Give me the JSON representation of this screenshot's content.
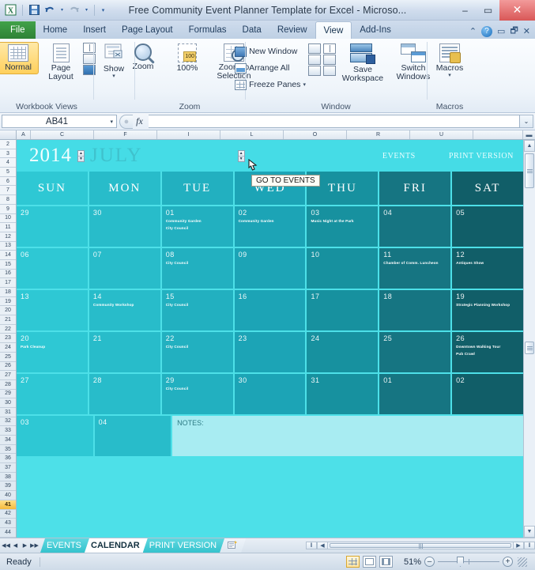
{
  "window": {
    "title": "Free Community Event Planner Template for Excel  -  Microso...",
    "minimize": "–",
    "maximize": "▭",
    "close": "✕",
    "app_icon": "X"
  },
  "quick_access": {
    "save": "save-icon",
    "undo": "↰",
    "undo_caret": "▾",
    "redo": "↱",
    "redo_caret": "▾",
    "customize": "▾"
  },
  "ribbon_tabs": {
    "file": "File",
    "items": [
      "Home",
      "Insert",
      "Page Layout",
      "Formulas",
      "Data",
      "Review",
      "View",
      "Add-Ins"
    ],
    "active": "View",
    "right_icons": [
      "up-caret-icon",
      "help-icon",
      "minimize-ribbon-icon",
      "restore-window-icon",
      "close-window-icon"
    ],
    "help_glyph": "?"
  },
  "ribbon": {
    "groups": [
      {
        "label": "Workbook Views",
        "buttons": [
          {
            "label_line1": "Normal",
            "label_line2": "",
            "selected": true
          },
          {
            "label_line1": "Page",
            "label_line2": "Layout",
            "selected": false
          }
        ]
      },
      {
        "label": "",
        "buttons": [
          {
            "label_line1": "Show",
            "label_line2": "",
            "caret": "▾"
          }
        ]
      },
      {
        "label": "Zoom",
        "buttons": [
          {
            "label_line1": "Zoom",
            "label_line2": ""
          },
          {
            "label_line1": "100%",
            "label_line2": ""
          },
          {
            "label_line1": "Zoom to",
            "label_line2": "Selection"
          }
        ]
      },
      {
        "label": "Window",
        "small_items": [
          "New Window",
          "Arrange All",
          "Freeze Panes"
        ],
        "freeze_caret": "▾",
        "buttons": [
          {
            "label_line1": "Save",
            "label_line2": "Workspace"
          },
          {
            "label_line1": "Switch",
            "label_line2": "Windows",
            "caret": "▾"
          }
        ]
      },
      {
        "label": "Macros",
        "buttons": [
          {
            "label_line1": "Macros",
            "label_line2": "",
            "caret": "▾"
          }
        ]
      }
    ]
  },
  "formula_bar": {
    "name_box_value": "AB41",
    "name_box_arrow": "▾",
    "cancel": "×",
    "enter": "✓",
    "fx": "fx",
    "formula_value": "",
    "expand_arrow": "⌄"
  },
  "grid": {
    "column_headers": [
      "A",
      "C",
      "F",
      "I",
      "L",
      "O",
      "R",
      "U"
    ],
    "row_numbers": [
      2,
      3,
      4,
      5,
      6,
      7,
      8,
      9,
      10,
      11,
      12,
      13,
      14,
      15,
      16,
      17,
      18,
      19,
      20,
      21,
      22,
      23,
      24,
      25,
      26,
      27,
      28,
      29,
      30,
      31,
      32,
      33,
      34,
      35,
      36,
      37,
      38,
      39,
      40,
      41,
      42,
      43,
      44
    ],
    "selected_row": 41,
    "select_all_corner": "select-all-icon"
  },
  "calendar": {
    "year": "2014",
    "month": "JULY",
    "links": [
      "EVENTS",
      "PRINT VERSION"
    ],
    "day_headers": [
      "SUN",
      "MON",
      "TUE",
      "WED",
      "THU",
      "FRI",
      "SAT"
    ],
    "notes_label": "NOTES:",
    "weeks": [
      [
        {
          "day": "29",
          "events": []
        },
        {
          "day": "30",
          "events": []
        },
        {
          "day": "01",
          "events": [
            "Community Garden",
            "City Council"
          ]
        },
        {
          "day": "02",
          "events": [
            "Community Garden"
          ]
        },
        {
          "day": "03",
          "events": [
            "Music Night at the Park"
          ]
        },
        {
          "day": "04",
          "events": []
        },
        {
          "day": "05",
          "events": []
        }
      ],
      [
        {
          "day": "06",
          "events": []
        },
        {
          "day": "07",
          "events": []
        },
        {
          "day": "08",
          "events": [
            "City Council"
          ]
        },
        {
          "day": "09",
          "events": []
        },
        {
          "day": "10",
          "events": []
        },
        {
          "day": "11",
          "events": [
            "Chamber of Comm. Luncheon"
          ]
        },
        {
          "day": "12",
          "events": [
            "Antiques Show"
          ]
        }
      ],
      [
        {
          "day": "13",
          "events": []
        },
        {
          "day": "14",
          "events": [
            "Community Workshop"
          ]
        },
        {
          "day": "15",
          "events": [
            "City Council"
          ]
        },
        {
          "day": "16",
          "events": []
        },
        {
          "day": "17",
          "events": []
        },
        {
          "day": "18",
          "events": []
        },
        {
          "day": "19",
          "events": [
            "Strategic Planning Workshop"
          ]
        }
      ],
      [
        {
          "day": "20",
          "events": [
            "Park Cleanup"
          ]
        },
        {
          "day": "21",
          "events": []
        },
        {
          "day": "22",
          "events": [
            "City Council"
          ]
        },
        {
          "day": "23",
          "events": []
        },
        {
          "day": "24",
          "events": []
        },
        {
          "day": "25",
          "events": []
        },
        {
          "day": "26",
          "events": [
            "Downtown Walking Tour",
            "Pub Crawl"
          ]
        }
      ],
      [
        {
          "day": "27",
          "events": []
        },
        {
          "day": "28",
          "events": []
        },
        {
          "day": "29",
          "events": [
            "City Council"
          ]
        },
        {
          "day": "30",
          "events": []
        },
        {
          "day": "31",
          "events": []
        },
        {
          "day": "01",
          "events": []
        },
        {
          "day": "02",
          "events": []
        }
      ],
      [
        {
          "day": "03",
          "events": []
        },
        {
          "day": "04",
          "events": []
        }
      ]
    ],
    "colors": {
      "background": "#4de0e8",
      "header_band": "#45dce6",
      "month_text": "#3fc2cd",
      "notes_bg": "#a8ecf2",
      "col_sun": "#2ec8d4",
      "col_mon": "#28bcca",
      "col_tue": "#22b0c0",
      "col_wed": "#1ca4b6",
      "col_thu": "#17919f",
      "col_fri": "#167582",
      "col_sat": "#115e68"
    }
  },
  "tooltip": {
    "text": "GO TO EVENTS"
  },
  "sheet_tabs": {
    "items": [
      {
        "label": "EVENTS",
        "active": false
      },
      {
        "label": "CALENDAR",
        "active": true
      },
      {
        "label": "PRINT VERSION",
        "active": false
      }
    ],
    "insert_sheet": "insert-worksheet-icon",
    "nav_first": "◀◀",
    "nav_prev": "◀",
    "nav_next": "▶",
    "nav_last": "▶▶"
  },
  "status_bar": {
    "state": "Ready",
    "view_buttons": [
      "normal-view",
      "page-layout-view",
      "page-break-view"
    ],
    "active_view": "normal-view",
    "zoom_level": "51%",
    "zoom_out": "–",
    "zoom_in": "+"
  }
}
